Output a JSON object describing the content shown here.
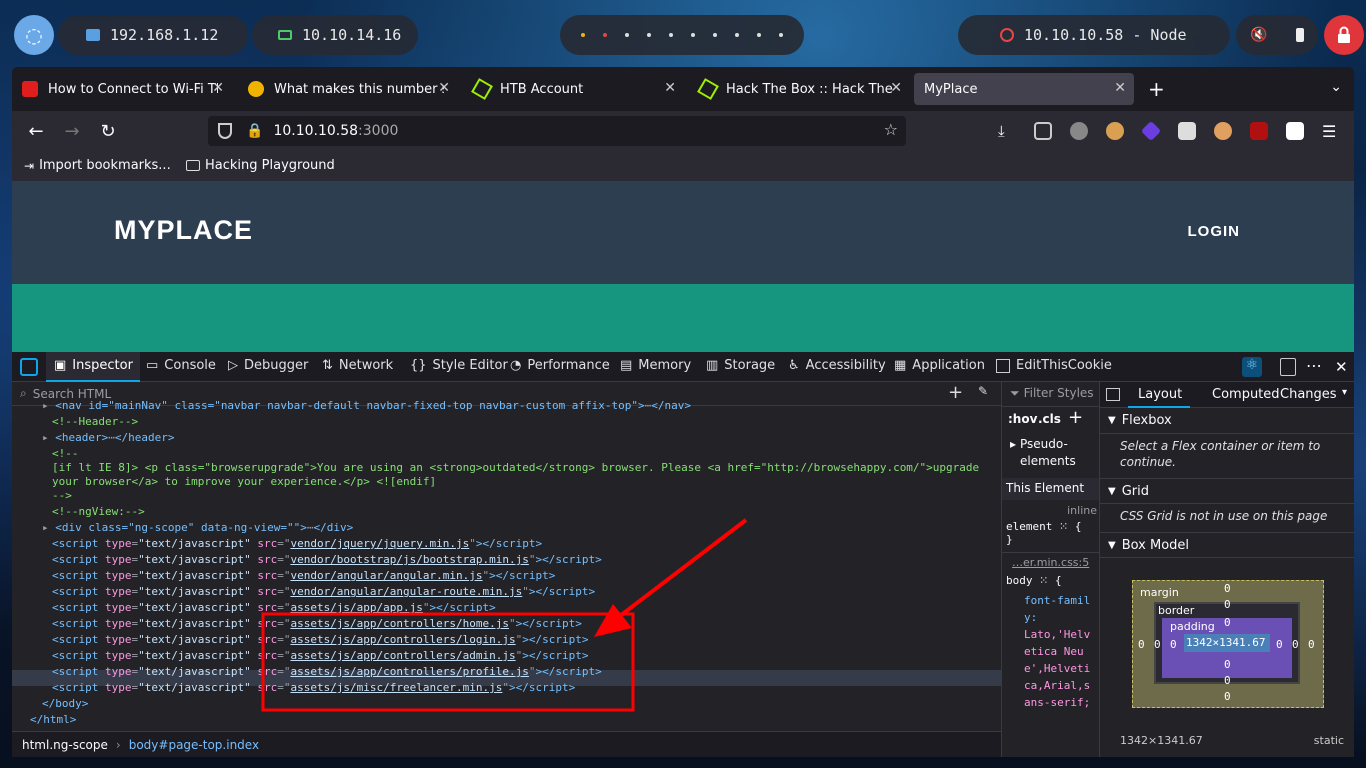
{
  "panel": {
    "ip_local": "192.168.1.12",
    "ip_vpn": "10.10.14.16",
    "target": "10.10.10.58 - Node"
  },
  "tabs": [
    {
      "label": "How to Connect to Wi-Fi Th",
      "favicon": "hulu-red"
    },
    {
      "label": "What makes this number s",
      "favicon": "compass-yellow"
    },
    {
      "label": "HTB Account",
      "favicon": "htb-green"
    },
    {
      "label": "Hack The Box :: Hack The B",
      "favicon": "htb-green"
    },
    {
      "label": "MyPlace",
      "favicon": "none",
      "active": true
    }
  ],
  "url": {
    "host": "10.10.10.58",
    "port": ":3000"
  },
  "bookmarks": [
    "Import bookmarks...",
    "Hacking Playground"
  ],
  "site": {
    "brand": "MYPLACE",
    "login": "LOGIN"
  },
  "devtools": {
    "tabs": [
      "Inspector",
      "Console",
      "Debugger",
      "Network",
      "Style Editor",
      "Performance",
      "Memory",
      "Storage",
      "Accessibility",
      "Application",
      "EditThisCookie"
    ],
    "search_placeholder": "Search HTML",
    "code": {
      "nav": "<nav id=\"mainNav\" class=\"navbar navbar-default navbar-fixed-top navbar-custom affix-top\">",
      "nav_close": "</nav>",
      "c_header": "<!--Header-->",
      "header_open": "<header>",
      "header_close": "</header>",
      "c1": "<!--",
      "c_ie1": "[if lt IE 8]> <p class=\"browserupgrade\">You are using an <strong>outdated</strong> browser. Please <a href=\"http://browsehappy.com/\">upgrade",
      "c_ie2": "your browser</a> to improve your experience.</p> <![endif]",
      "c_end": "-->",
      "c_ngview": "<!--ngView:-->",
      "div_open": "<div class=\"ng-scope\" data-ng-view=\"\">",
      "div_close": "</div>",
      "scripts": [
        "vendor/jquery/jquery.min.js",
        "vendor/bootstrap/js/bootstrap.min.js",
        "vendor/angular/angular.min.js",
        "vendor/angular/angular-route.min.js",
        "assets/js/app/app.js",
        "assets/js/app/controllers/home.js",
        "assets/js/app/controllers/login.js",
        "assets/js/app/controllers/admin.js",
        "assets/js/app/controllers/profile.js",
        "assets/js/misc/freelancer.min.js"
      ],
      "body_close": "</body>",
      "html_close": "</html>"
    },
    "breadcrumbs": [
      "html.ng-scope",
      "body#page-top.index"
    ],
    "rules": {
      "filter": "Filter Styles",
      "hov": ":hov",
      "cls": ".cls",
      "pseudo": "Pseudo-elements",
      "this_element": "This Element",
      "inline": "inline",
      "element": "element",
      "source": "…er.min.css:5",
      "body": "body",
      "prop": "font-family:",
      "value": "Lato,'Helvetica Neue',Helvetica,Arial,sans-serif;"
    },
    "layout": {
      "tabs": [
        "Layout",
        "Computed",
        "Changes"
      ],
      "flexbox": "Flexbox",
      "flex_note": "Select a Flex container or item to continue.",
      "grid": "Grid",
      "grid_note": "CSS Grid is not in use on this page",
      "boxmodel": "Box Model",
      "margin": "margin",
      "border": "border",
      "padding": "padding",
      "size": "1342×1341.67",
      "zero": "0",
      "position": "static"
    }
  },
  "annotation": {
    "color": "#ff0000"
  }
}
